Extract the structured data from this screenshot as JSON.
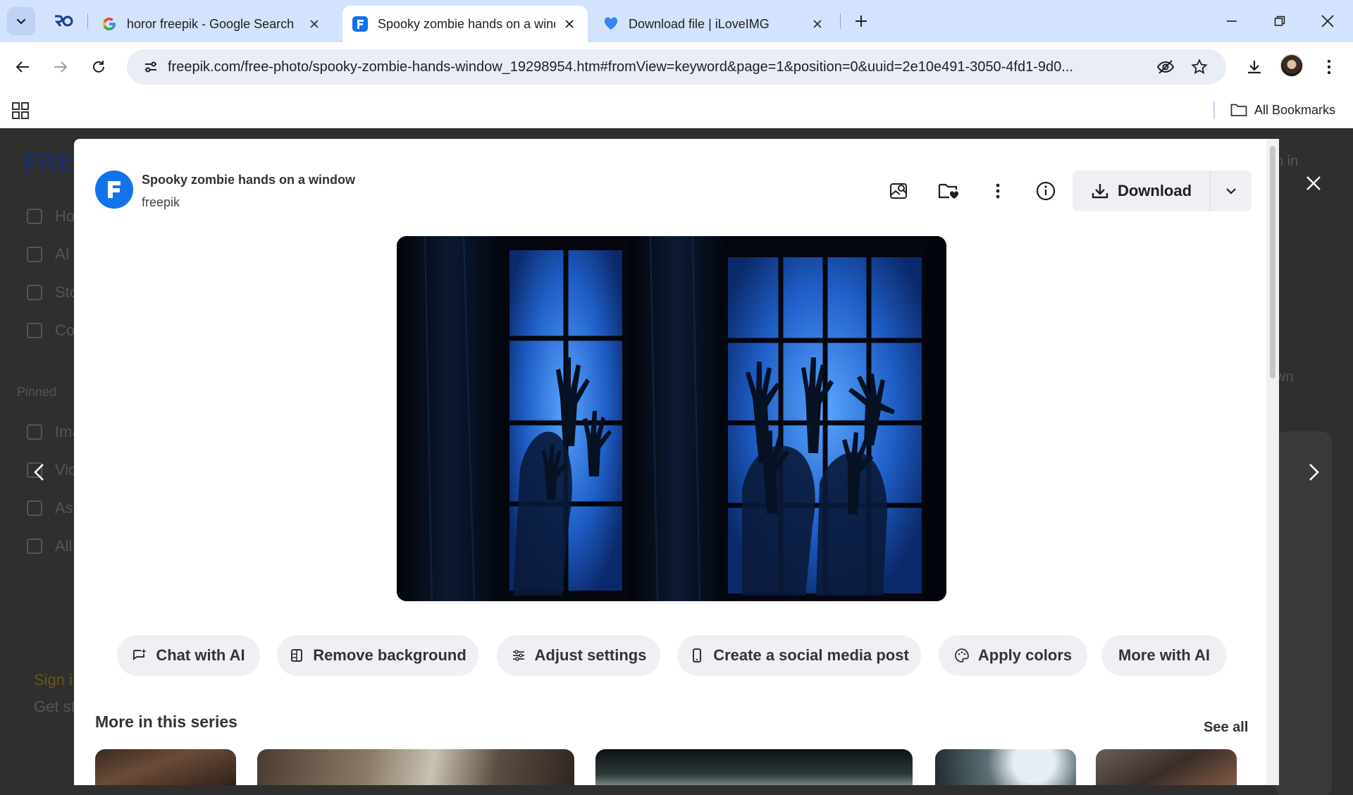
{
  "browser": {
    "tabs": [
      {
        "title": "horor freepik - Google Search",
        "favicon": "google-g"
      },
      {
        "title": "Spooky zombie hands on a window",
        "favicon": "freepik-f",
        "active": true
      },
      {
        "title": "Download file | iLoveIMG",
        "favicon": "heart"
      }
    ],
    "pinned_tab_icon": "ro-logo",
    "url": "freepik.com/free-photo/spooky-zombie-hands-window_19298954.htm#fromView=keyword&page=1&position=0&uuid=2e10e491-3050-4fd1-9d0...",
    "bookmarks_label": "All Bookmarks"
  },
  "background_page": {
    "logo": "FRE",
    "sidebar_items": [
      "Ho",
      "AI",
      "Sto",
      "Co"
    ],
    "pinned_label": "Pinned",
    "pinned_items": [
      "Ima",
      "Vid",
      "As",
      "All"
    ],
    "sign_in": "Sign i",
    "get_started": "Get st",
    "right_texts": [
      "n in",
      "wn"
    ]
  },
  "modal": {
    "title": "Spooky zombie hands on a window",
    "author": "freepik",
    "download_label": "Download",
    "ai_actions": [
      {
        "label": "Chat with AI",
        "icon": "chat-ai-icon"
      },
      {
        "label": "Remove background",
        "icon": "remove-bg-icon"
      },
      {
        "label": "Adjust settings",
        "icon": "sliders-icon"
      },
      {
        "label": "Create a social media post",
        "icon": "phone-icon"
      },
      {
        "label": "Apply colors",
        "icon": "palette-icon"
      },
      {
        "label": "More with AI",
        "icon": ""
      }
    ],
    "series_title": "More in this series",
    "see_all": "See all"
  },
  "colors": {
    "tabstrip": "#d3e3fd",
    "freepik_blue": "#1273eb",
    "pill_bg": "#eef0f3"
  }
}
